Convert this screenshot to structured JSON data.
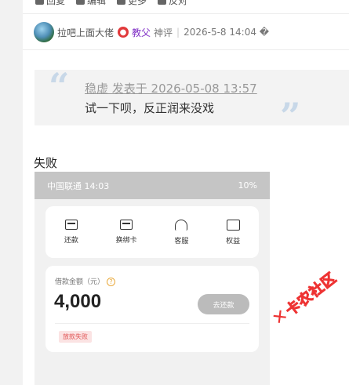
{
  "actions": {
    "reply": "回复",
    "edit": "编辑",
    "share": "更多",
    "report": "反对"
  },
  "post_meta": {
    "username": "拉吧上面大佬",
    "title": "教父",
    "rank": "神评",
    "datetime": "2026-5-8 14:04 �"
  },
  "quote": {
    "line1": "稳虚 发表于 2026-05-08 13:57",
    "line2": "试一下呗，反正润来没戏"
  },
  "post_text": "失败",
  "phone": {
    "status_left": "中国联通 14:03",
    "status_right": "10%",
    "services": [
      "还款",
      "换绑卡",
      "客服",
      "权益"
    ],
    "amount_label": "借款金额（元）",
    "amount": "4,000",
    "repay_button": "去还款",
    "status_tag": "放款失败"
  },
  "watermark": "卡农社区"
}
